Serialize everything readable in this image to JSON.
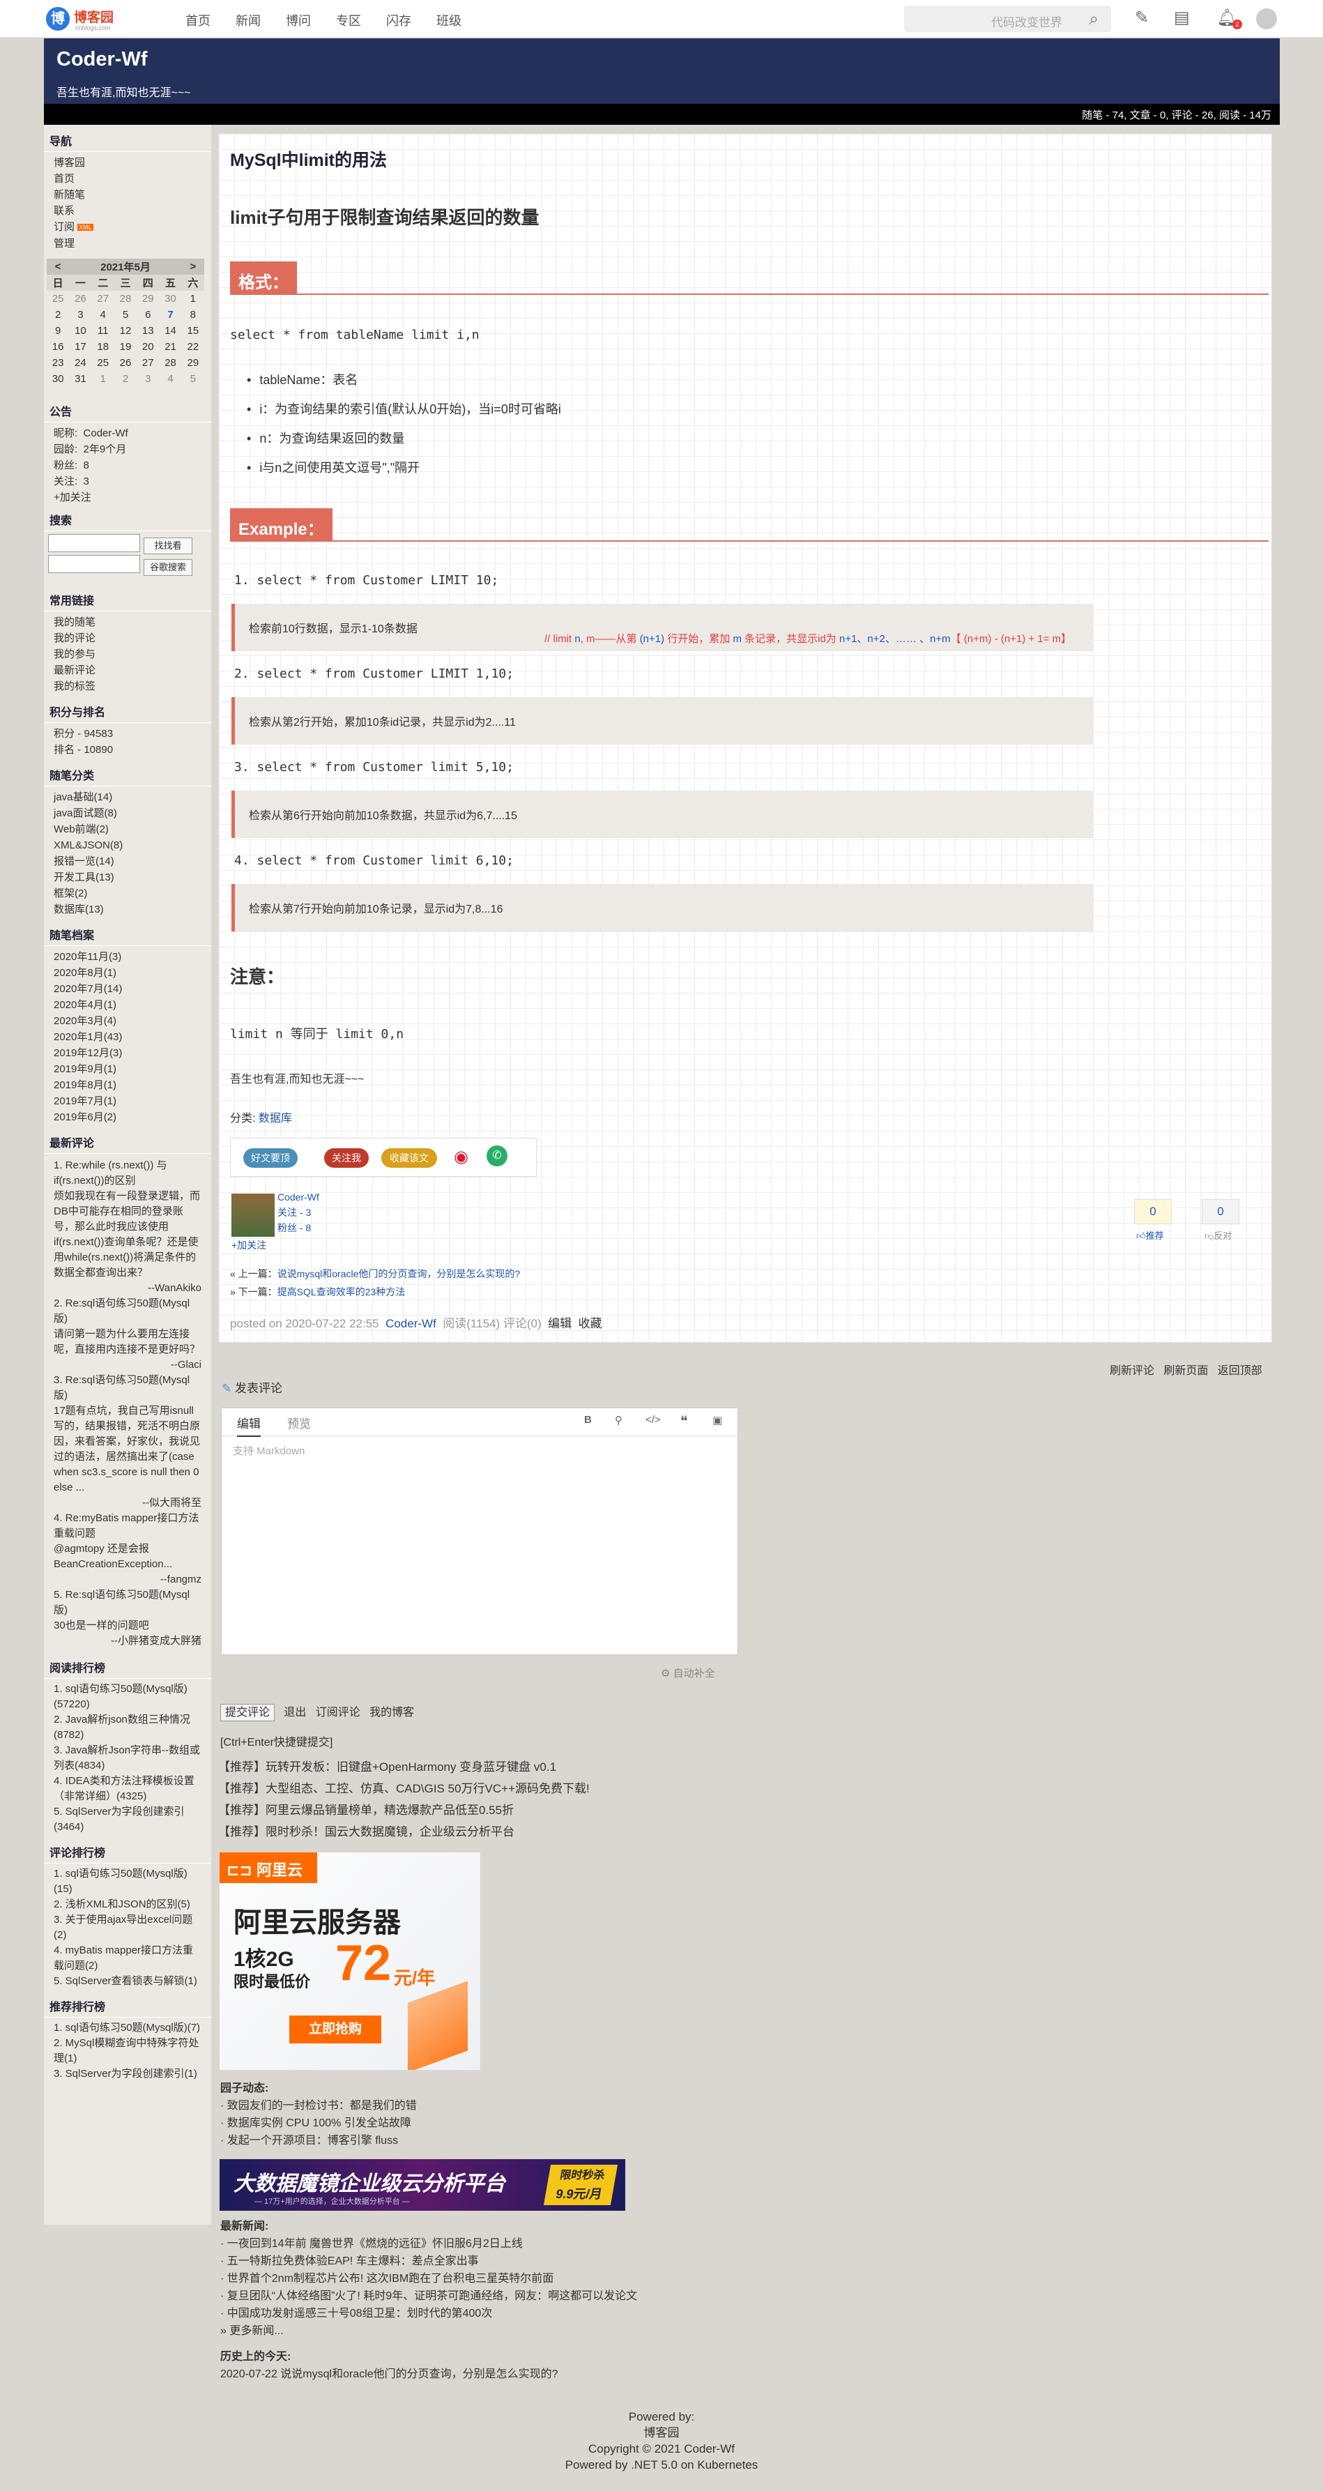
{
  "topnav": {
    "logo_mark": "博",
    "logo_text": "博客园",
    "logo_sub": "cnblogs.com",
    "links": [
      "首页",
      "新闻",
      "博问",
      "专区",
      "闪存",
      "班级"
    ],
    "search_placeholder": "代码改变世界",
    "notify_count": "2"
  },
  "blog": {
    "title": "Coder-Wf",
    "subtitle": "吾生也有涯,而知也无涯~~~",
    "stats": "随笔 - 74, 文章 - 0, 评论 - 26, 阅读 - 14万"
  },
  "sidebar": {
    "nav_title": "导航",
    "nav": [
      "博客园",
      "首页",
      "新随笔",
      "联系",
      "订阅",
      "管理"
    ],
    "rss": "XML",
    "calendar": {
      "prev": "<",
      "next": ">",
      "month": "2021年5月",
      "weekdays": [
        "日",
        "一",
        "二",
        "三",
        "四",
        "五",
        "六"
      ],
      "weeks": [
        [
          "25",
          "26",
          "27",
          "28",
          "29",
          "30",
          "1"
        ],
        [
          "2",
          "3",
          "4",
          "5",
          "6",
          "7",
          "8"
        ],
        [
          "9",
          "10",
          "11",
          "12",
          "13",
          "14",
          "15"
        ],
        [
          "16",
          "17",
          "18",
          "19",
          "20",
          "21",
          "22"
        ],
        [
          "23",
          "24",
          "25",
          "26",
          "27",
          "28",
          "29"
        ],
        [
          "30",
          "31",
          "1",
          "2",
          "3",
          "4",
          "5"
        ]
      ]
    },
    "notice_title": "公告",
    "notice": [
      {
        "k": "昵称:",
        "v": "Coder-Wf"
      },
      {
        "k": "园龄:",
        "v": "2年9个月"
      },
      {
        "k": "粉丝:",
        "v": "8"
      },
      {
        "k": "关注:",
        "v": "3"
      }
    ],
    "follow": "+加关注",
    "search_title": "搜索",
    "search_btn1": "找找看",
    "search_btn2": "谷歌搜索",
    "links_title": "常用链接",
    "links": [
      "我的随笔",
      "我的评论",
      "我的参与",
      "最新评论",
      "我的标签"
    ],
    "score_title": "积分与排名",
    "score": [
      "积分 - 94583",
      "排名 - 10890"
    ],
    "cat_title": "随笔分类",
    "cats": [
      "java基础(14)",
      "java面试题(8)",
      "Web前端(2)",
      "XML&JSON(8)",
      "报错一览(14)",
      "开发工具(13)",
      "框架(2)",
      "数据库(13)"
    ],
    "arch_title": "随笔档案",
    "archives": [
      "2020年11月(3)",
      "2020年8月(1)",
      "2020年7月(14)",
      "2020年4月(1)",
      "2020年3月(4)",
      "2020年1月(43)",
      "2019年12月(3)",
      "2019年9月(1)",
      "2019年8月(1)",
      "2019年7月(1)",
      "2019年6月(2)"
    ],
    "cmt_title": "最新评论",
    "comments": [
      {
        "t": "1. Re:while (rs.next()) 与if(rs.next())的区别",
        "b": "烦如我现在有一段登录逻辑，而DB中可能存在相同的登录账号，那么此时我应该使用if(rs.next())查询单条呢？还是使用while(rs.next())将满足条件的数据全都查询出来？",
        "a": "--WanAkiko"
      },
      {
        "t": "2. Re:sql语句练习50题(Mysql版)",
        "b": "请问第一题为什么要用左连接呢，直接用内连接不是更好吗？",
        "a": "--Glaci"
      },
      {
        "t": "3. Re:sql语句练习50题(Mysql版)",
        "b": "17题有点坑，我自己写用isnull写的，结果报错，死活不明白原因，来看答案，好家伙，我说见过的语法，居然搞出来了(case when sc3.s_score is null then 0 else ...",
        "a": "--似大雨将至"
      },
      {
        "t": "4. Re:myBatis mapper接口方法重载问题",
        "b": "@agmtopy 还是会报BeanCreationException...",
        "a": "--fangmz"
      },
      {
        "t": "5. Re:sql语句练习50题(Mysql版)",
        "b": "30也是一样的问题吧",
        "a": "--小胖猪变成大胖猪"
      }
    ],
    "read_title": "阅读排行榜",
    "reads": [
      "1. sql语句练习50题(Mysql版)(57220)",
      "2. Java解析json数组三种情况(8782)",
      "3. Java解析Json字符串--数组或列表(4834)",
      "4. IDEA类和方法注释模板设置（非常详细）(4325)",
      "5. SqlServer为字段创建索引(3464)"
    ],
    "cmtrank_title": "评论排行榜",
    "cmtrank": [
      "1. sql语句练习50题(Mysql版)(15)",
      "2. 浅析XML和JSON的区别(5)",
      "3. 关于使用ajax导出excel问题(2)",
      "4. myBatis mapper接口方法重载问题(2)",
      "5. SqlServer查看锁表与解锁(1)"
    ],
    "rec_title": "推荐排行榜",
    "recs": [
      "1. sql语句练习50题(Mysql版)(7)",
      "2. MySql模糊查询中特殊字符处理(1)",
      "3. SqlServer为字段创建索引(1)"
    ]
  },
  "post": {
    "title": "MySql中limit的用法",
    "h2": "limit子句用于限制查询结果返回的数量",
    "sec1": "格式：",
    "syntax": "select * from tableName limit i,n",
    "bullets": [
      "tableName：表名",
      "i：为查询结果的索引值(默认从0开始)，当i=0时可省略i",
      "n：为查询结果返回的数量",
      "i与n之间使用英文逗号\",\"隔开"
    ],
    "sec2": "Example：",
    "examples": [
      {
        "sql": "1. select * from Customer LIMIT 10;",
        "desc": "检索前10行数据，显示1-10条数据"
      },
      {
        "sql": "2. select * from Customer LIMIT 1,10;",
        "desc": "检索从第2行开始，累加10条id记录，共显示id为2....11"
      },
      {
        "sql": "3. select * from Customer limit 5,10;",
        "desc": "检索从第6行开始向前加10条数据，共显示id为6,7....15"
      },
      {
        "sql": "4. select * from Customer limit 6,10;",
        "desc": "检索从第7行开始向前加10条记录，显示id为7,8...16"
      }
    ],
    "annotation": {
      "a": "// limit ",
      "b": "n",
      "c": ", m——从第 ",
      "d": "(n+1)",
      "e": " 行开始，累加 ",
      "f": "m",
      "g": " 条记录，共显示id为 ",
      "h": "n+1、n+2、…… 、n+m",
      "i": "【 (n+m) - (n+1) + 1= m】"
    },
    "note_title": "注意：",
    "note": "limit n 等同于 limit 0,n",
    "signature": "吾生也有涯,而知也无涯~~~",
    "category_label": "分类: ",
    "category": "数据库",
    "share": [
      "好文要顶",
      "关注我",
      "收藏该文"
    ],
    "author": "Coder-Wf",
    "author_follow": "关注 - 3",
    "author_fans": "粉丝 - 8",
    "author_add": "+加关注",
    "digg": "0",
    "digg_label": "推荐",
    "bury": "0",
    "bury_label": "反对",
    "prev_label": "« 上一篇：",
    "prev": "说说mysql和oracle他门的分页查询，分别是怎么实现的?",
    "next_label": "» 下一篇：",
    "next": "提高SQL查询效率的23种方法",
    "footer_posted": "posted on 2020-07-22 22:55",
    "footer_author": "Coder-Wf",
    "footer_stats": "阅读(1154)  评论(0)",
    "footer_edit": "编辑",
    "footer_fav": "收藏"
  },
  "comments_area": {
    "refresh": "刷新评论",
    "refresh_page": "刷新页面",
    "top": "返回顶部",
    "post_title": "发表评论",
    "tab_edit": "编辑",
    "tab_preview": "预览",
    "placeholder": "支持 Markdown",
    "autocomplete": "自动补全",
    "submit": "提交评论",
    "logout": "退出",
    "subscribe": "订阅评论",
    "myblog": "我的博客",
    "hint": "[Ctrl+Enter快捷键提交]"
  },
  "promos": [
    "【推荐】玩转开发板：旧键盘+OpenHarmony 变身蓝牙键盘 v0.1",
    "【推荐】大型组态、工控、仿真、CAD\\GIS 50万行VC++源码免费下载!",
    "【推荐】阿里云爆品销量榜单，精选爆款产品低至0.55折",
    "【推荐】限时秒杀！国云大数据魔镜，企业级云分析平台"
  ],
  "ad1": {
    "brand": "阿里云",
    "title": "阿里云服务器",
    "spec": "1核2G",
    "price_label": "限时最低价",
    "price": "72",
    "unit": "元/年",
    "cta": "立即抢购"
  },
  "garden": {
    "title": "园子动态:",
    "items": [
      "· 致园友们的一封检讨书：都是我们的错",
      "· 数据库实例 CPU 100% 引发全站故障",
      "· 发起一个开源项目：博客引擎 fluss"
    ]
  },
  "ad2": {
    "text": "大数据魔镜企业级云分析平台",
    "sub": "— 17万+用户的选择，企业大数据分析平台 —",
    "badge1": "限时秒杀",
    "badge2": "9.9元/月"
  },
  "news": {
    "title": "最新新闻:",
    "items": [
      "· 一夜回到14年前 魔兽世界《燃烧的远征》怀旧服6月2日上线",
      "· 五一特斯拉免费体验EAP! 车主爆料：差点全家出事",
      "· 世界首个2nm制程芯片公布! 这次IBM跑在了台积电三星英特尔前面",
      "· 复旦团队“人体经络图”火了! 耗时9年、证明茶可跑通经络，网友：啊这都可以发论文",
      "· 中国成功发射遥感三十号08组卫星：划时代的第400次"
    ],
    "more": "» 更多新闻..."
  },
  "history": {
    "title": "历史上的今天:",
    "item": "2020-07-22 说说mysql和oracle他门的分页查询，分别是怎么实现的?"
  },
  "footer": [
    "Powered by:",
    "博客园",
    "Copyright © 2021 Coder-Wf",
    "Powered by .NET 5.0 on Kubernetes"
  ]
}
